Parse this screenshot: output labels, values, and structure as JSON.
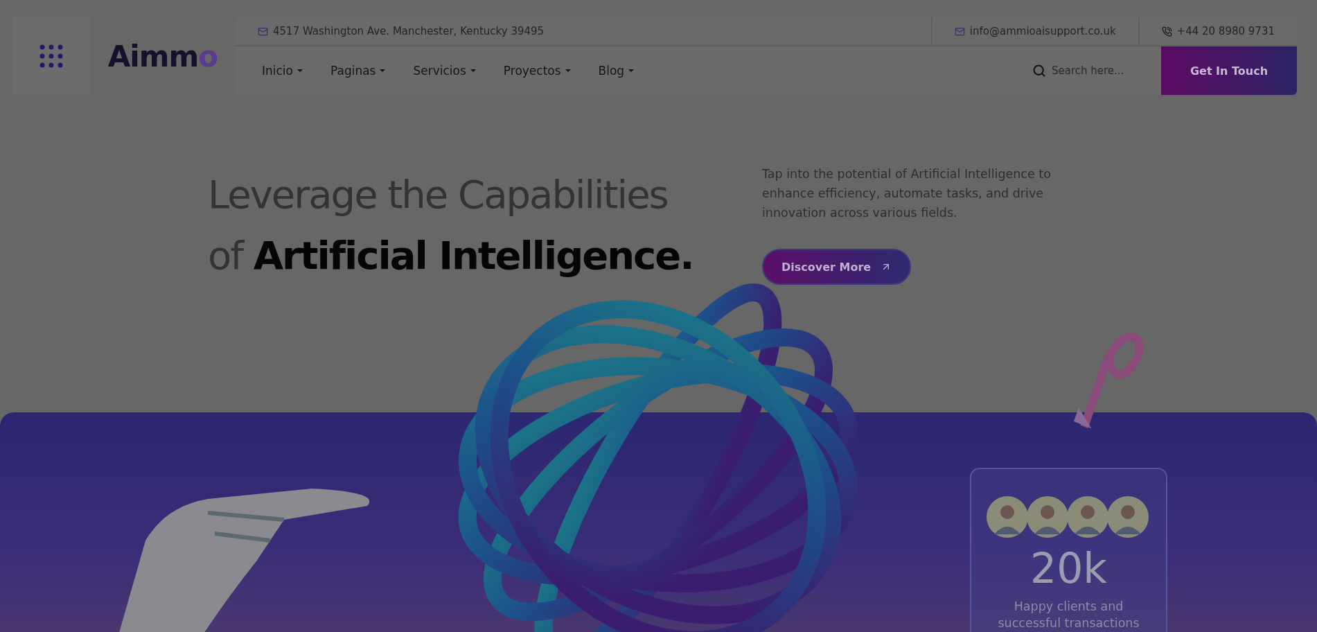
{
  "header": {
    "logo": {
      "text": "Aimm",
      "accent": "o"
    },
    "address": "4517 Washington Ave. Manchester, Kentucky 39495",
    "email": "info@ammioaisupport.co.uk",
    "phone": "+44 20 8980 9731",
    "nav": [
      {
        "label": "Inicio"
      },
      {
        "label": "Paginas"
      },
      {
        "label": "Servicios"
      },
      {
        "label": "Proyectos"
      },
      {
        "label": "Blog"
      }
    ],
    "search": {
      "placeholder": "Search here..."
    },
    "cta": "Get In Touch"
  },
  "hero": {
    "title_line1": "Leverage the Capabilities",
    "title_line2": "of **Artificial Intelligence.**",
    "description": "Tap into the potential of Artificial Intelligence to enhance efficiency, automate tasks, and drive innovation across various fields.",
    "button": "Discover More"
  },
  "stats": {
    "value": "20k",
    "label": "Happy clients and successful transactions"
  }
}
